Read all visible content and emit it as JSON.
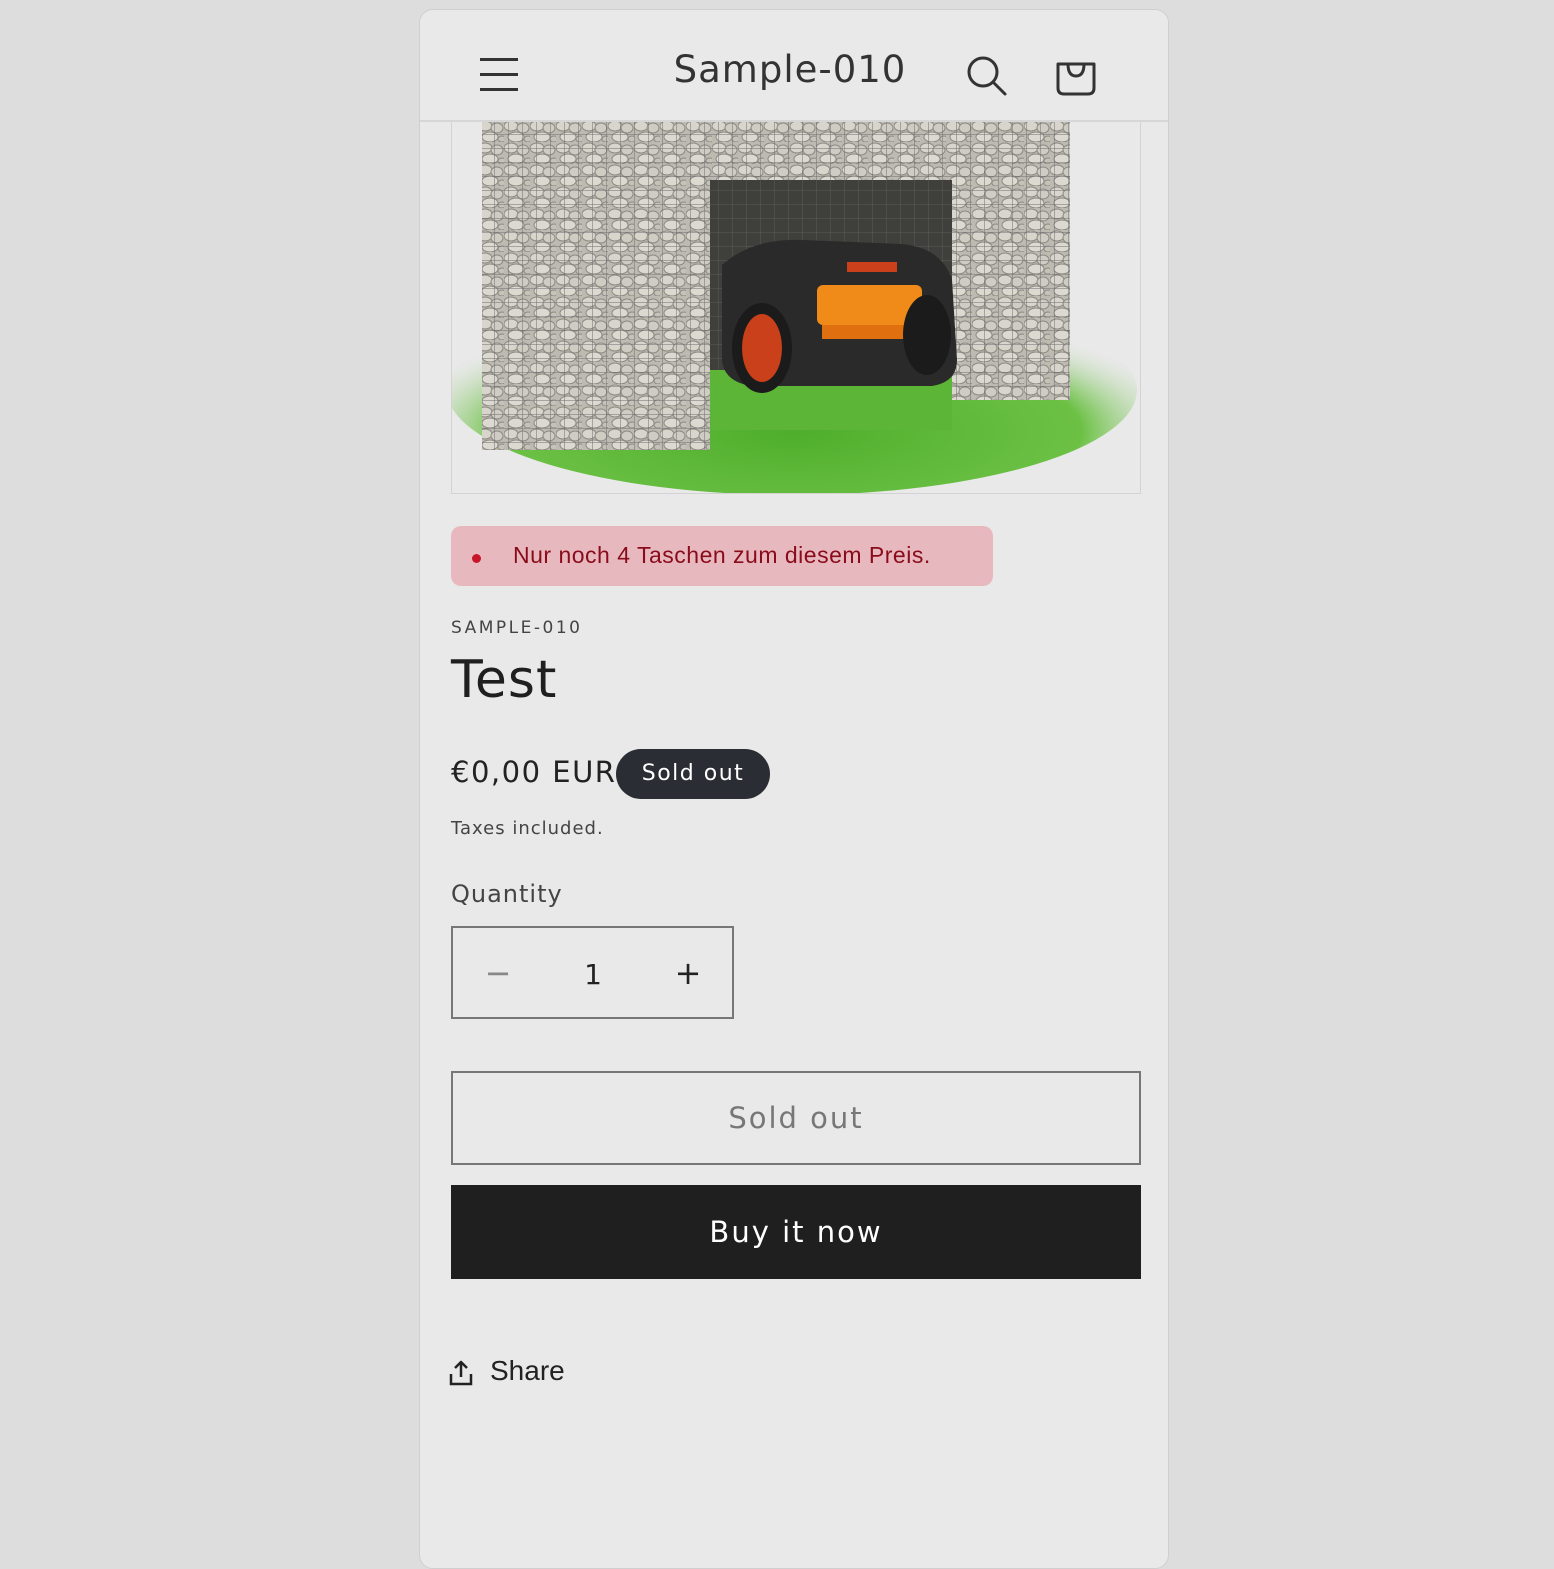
{
  "header": {
    "store_name": "Sample-010",
    "icons": [
      "menu-icon",
      "search-icon",
      "cart-icon"
    ]
  },
  "product": {
    "image_alt": "Gabion garage with robotic lawn mower",
    "stock_alert": "Nur noch 4 Taschen zum diesem Preis.",
    "vendor": "SAMPLE-010",
    "title": "Test",
    "price": "€0,00 EUR",
    "badge": "Sold out",
    "taxes_note": "Taxes included.",
    "quantity_label": "Quantity",
    "quantity_value": "1",
    "quantity_minus": "−",
    "quantity_plus": "+",
    "add_to_cart_label": "Sold out",
    "buy_now_label": "Buy it now",
    "share_label": "Share"
  },
  "colors": {
    "page_bg": "#e9e9e9",
    "alert_bg": "#e7b9be",
    "alert_text": "#8a0b1b",
    "badge_bg": "#2a2d33",
    "buy_button_bg": "#1f1f1f"
  }
}
